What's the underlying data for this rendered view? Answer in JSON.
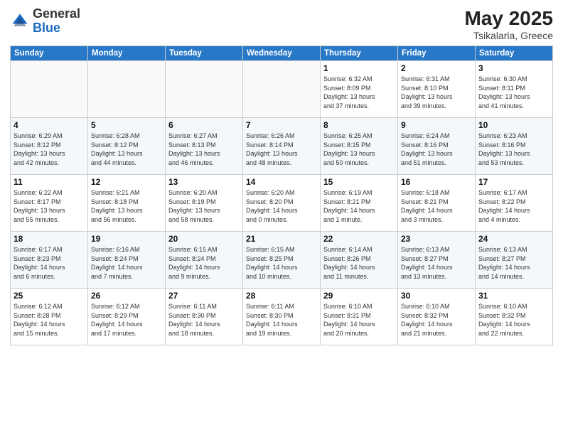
{
  "header": {
    "logo_general": "General",
    "logo_blue": "Blue",
    "month_year": "May 2025",
    "location": "Tsikalaria, Greece"
  },
  "days_of_week": [
    "Sunday",
    "Monday",
    "Tuesday",
    "Wednesday",
    "Thursday",
    "Friday",
    "Saturday"
  ],
  "weeks": [
    [
      {
        "num": "",
        "info": ""
      },
      {
        "num": "",
        "info": ""
      },
      {
        "num": "",
        "info": ""
      },
      {
        "num": "",
        "info": ""
      },
      {
        "num": "1",
        "info": "Sunrise: 6:32 AM\nSunset: 8:09 PM\nDaylight: 13 hours\nand 37 minutes."
      },
      {
        "num": "2",
        "info": "Sunrise: 6:31 AM\nSunset: 8:10 PM\nDaylight: 13 hours\nand 39 minutes."
      },
      {
        "num": "3",
        "info": "Sunrise: 6:30 AM\nSunset: 8:11 PM\nDaylight: 13 hours\nand 41 minutes."
      }
    ],
    [
      {
        "num": "4",
        "info": "Sunrise: 6:29 AM\nSunset: 8:12 PM\nDaylight: 13 hours\nand 42 minutes."
      },
      {
        "num": "5",
        "info": "Sunrise: 6:28 AM\nSunset: 8:12 PM\nDaylight: 13 hours\nand 44 minutes."
      },
      {
        "num": "6",
        "info": "Sunrise: 6:27 AM\nSunset: 8:13 PM\nDaylight: 13 hours\nand 46 minutes."
      },
      {
        "num": "7",
        "info": "Sunrise: 6:26 AM\nSunset: 8:14 PM\nDaylight: 13 hours\nand 48 minutes."
      },
      {
        "num": "8",
        "info": "Sunrise: 6:25 AM\nSunset: 8:15 PM\nDaylight: 13 hours\nand 50 minutes."
      },
      {
        "num": "9",
        "info": "Sunrise: 6:24 AM\nSunset: 8:16 PM\nDaylight: 13 hours\nand 51 minutes."
      },
      {
        "num": "10",
        "info": "Sunrise: 6:23 AM\nSunset: 8:16 PM\nDaylight: 13 hours\nand 53 minutes."
      }
    ],
    [
      {
        "num": "11",
        "info": "Sunrise: 6:22 AM\nSunset: 8:17 PM\nDaylight: 13 hours\nand 55 minutes."
      },
      {
        "num": "12",
        "info": "Sunrise: 6:21 AM\nSunset: 8:18 PM\nDaylight: 13 hours\nand 56 minutes."
      },
      {
        "num": "13",
        "info": "Sunrise: 6:20 AM\nSunset: 8:19 PM\nDaylight: 13 hours\nand 58 minutes."
      },
      {
        "num": "14",
        "info": "Sunrise: 6:20 AM\nSunset: 8:20 PM\nDaylight: 14 hours\nand 0 minutes."
      },
      {
        "num": "15",
        "info": "Sunrise: 6:19 AM\nSunset: 8:21 PM\nDaylight: 14 hours\nand 1 minute."
      },
      {
        "num": "16",
        "info": "Sunrise: 6:18 AM\nSunset: 8:21 PM\nDaylight: 14 hours\nand 3 minutes."
      },
      {
        "num": "17",
        "info": "Sunrise: 6:17 AM\nSunset: 8:22 PM\nDaylight: 14 hours\nand 4 minutes."
      }
    ],
    [
      {
        "num": "18",
        "info": "Sunrise: 6:17 AM\nSunset: 8:23 PM\nDaylight: 14 hours\nand 6 minutes."
      },
      {
        "num": "19",
        "info": "Sunrise: 6:16 AM\nSunset: 8:24 PM\nDaylight: 14 hours\nand 7 minutes."
      },
      {
        "num": "20",
        "info": "Sunrise: 6:15 AM\nSunset: 8:24 PM\nDaylight: 14 hours\nand 9 minutes."
      },
      {
        "num": "21",
        "info": "Sunrise: 6:15 AM\nSunset: 8:25 PM\nDaylight: 14 hours\nand 10 minutes."
      },
      {
        "num": "22",
        "info": "Sunrise: 6:14 AM\nSunset: 8:26 PM\nDaylight: 14 hours\nand 11 minutes."
      },
      {
        "num": "23",
        "info": "Sunrise: 6:13 AM\nSunset: 8:27 PM\nDaylight: 14 hours\nand 13 minutes."
      },
      {
        "num": "24",
        "info": "Sunrise: 6:13 AM\nSunset: 8:27 PM\nDaylight: 14 hours\nand 14 minutes."
      }
    ],
    [
      {
        "num": "25",
        "info": "Sunrise: 6:12 AM\nSunset: 8:28 PM\nDaylight: 14 hours\nand 15 minutes."
      },
      {
        "num": "26",
        "info": "Sunrise: 6:12 AM\nSunset: 8:29 PM\nDaylight: 14 hours\nand 17 minutes."
      },
      {
        "num": "27",
        "info": "Sunrise: 6:11 AM\nSunset: 8:30 PM\nDaylight: 14 hours\nand 18 minutes."
      },
      {
        "num": "28",
        "info": "Sunrise: 6:11 AM\nSunset: 8:30 PM\nDaylight: 14 hours\nand 19 minutes."
      },
      {
        "num": "29",
        "info": "Sunrise: 6:10 AM\nSunset: 8:31 PM\nDaylight: 14 hours\nand 20 minutes."
      },
      {
        "num": "30",
        "info": "Sunrise: 6:10 AM\nSunset: 8:32 PM\nDaylight: 14 hours\nand 21 minutes."
      },
      {
        "num": "31",
        "info": "Sunrise: 6:10 AM\nSunset: 8:32 PM\nDaylight: 14 hours\nand 22 minutes."
      }
    ]
  ],
  "colors": {
    "header_bg": "#2878c8",
    "header_text": "#ffffff",
    "row_even_bg": "#f4f8fd",
    "row_odd_bg": "#ffffff"
  }
}
